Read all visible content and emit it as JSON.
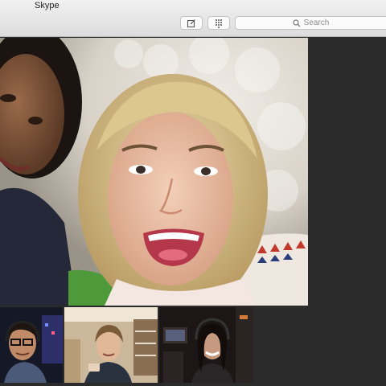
{
  "window": {
    "app_title": "Skype"
  },
  "toolbar": {
    "compose_icon": "compose-icon",
    "dialpad_icon": "dialpad-icon",
    "search_icon": "search-icon",
    "search_placeholder": "Search"
  },
  "call": {
    "main_participant": "main-video-feed",
    "thumbnails": [
      "participant-thumbnail-1",
      "participant-thumbnail-2",
      "participant-thumbnail-3"
    ]
  },
  "colors": {
    "toolbar_bg": "#e4e4e4",
    "stage_bg": "#2b2b2b"
  }
}
